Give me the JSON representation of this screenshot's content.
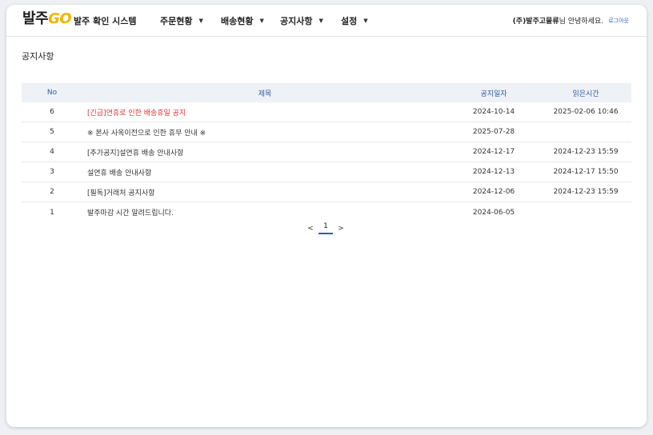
{
  "header": {
    "logo_ko": "발주",
    "logo_go": "GO",
    "system_title": "발주 확인 시스템",
    "nav": [
      {
        "label": "주문현황"
      },
      {
        "label": "배송현황"
      },
      {
        "label": "공지사항"
      },
      {
        "label": "설정"
      }
    ],
    "user_company": "(주)발주고물류",
    "user_greeting": "님 안녕하세요.",
    "logout_label": "로그아웃"
  },
  "page": {
    "title": "공지사항"
  },
  "table": {
    "columns": {
      "no": "No",
      "title": "제목",
      "date": "공지일자",
      "read": "읽은시간"
    },
    "rows": [
      {
        "no": "6",
        "title": "[긴급]연휴로 인한 배송휴일 공지",
        "date": "2024-10-14",
        "read": "2025-02-06 10:46"
      },
      {
        "no": "5",
        "title": "※ 본사 사옥이전으로 인한 휴무 안내 ※",
        "date": "2025-07-28",
        "read": ""
      },
      {
        "no": "4",
        "title": "[추가공지]설연휴 배송 안내사항",
        "date": "2024-12-17",
        "read": "2024-12-23 15:59"
      },
      {
        "no": "3",
        "title": "설연휴 배송 안내사항",
        "date": "2024-12-13",
        "read": "2024-12-17 15:50"
      },
      {
        "no": "2",
        "title": "[필독]거래처 공지사항",
        "date": "2024-12-06",
        "read": "2024-12-23 15:59"
      },
      {
        "no": "1",
        "title": "발주마감 시간 알려드립니다.",
        "date": "2024-06-05",
        "read": ""
      }
    ]
  },
  "pagination": {
    "prev": "<",
    "current": "1",
    "next": ">"
  },
  "colors": {
    "accent": "#2b5fa8",
    "urgent": "#d9383a",
    "logo_yellow": "#f5b400"
  },
  "icons": {
    "caret": "caret-down-icon"
  }
}
